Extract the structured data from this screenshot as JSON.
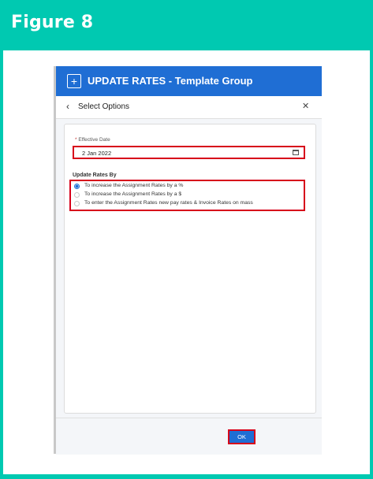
{
  "figure": {
    "title": "Figure 8"
  },
  "app": {
    "title": "UPDATE RATES - Template Group"
  },
  "modal": {
    "title": "Select Options",
    "effective_date": {
      "required_marker": "*",
      "label": "Effective Date",
      "value": "2 Jan 2022"
    },
    "update_rates_by": {
      "label": "Update Rates By",
      "options": [
        {
          "label": "To increase the Assignment Rates by a %",
          "selected": true
        },
        {
          "label": "To increase the Assignment Rates by a $",
          "selected": false
        },
        {
          "label": "To enter the Assignment Rates new pay rates & Invoice Rates on mass",
          "selected": false
        }
      ]
    },
    "ok_label": "OK"
  },
  "colors": {
    "frame": "#00c9b1",
    "header": "#1f6ed4",
    "highlight": "#d7001a"
  },
  "icons": {
    "add": "plus-square-icon",
    "back": "chevron-left-icon",
    "close": "close-icon",
    "calendar": "calendar-icon"
  }
}
